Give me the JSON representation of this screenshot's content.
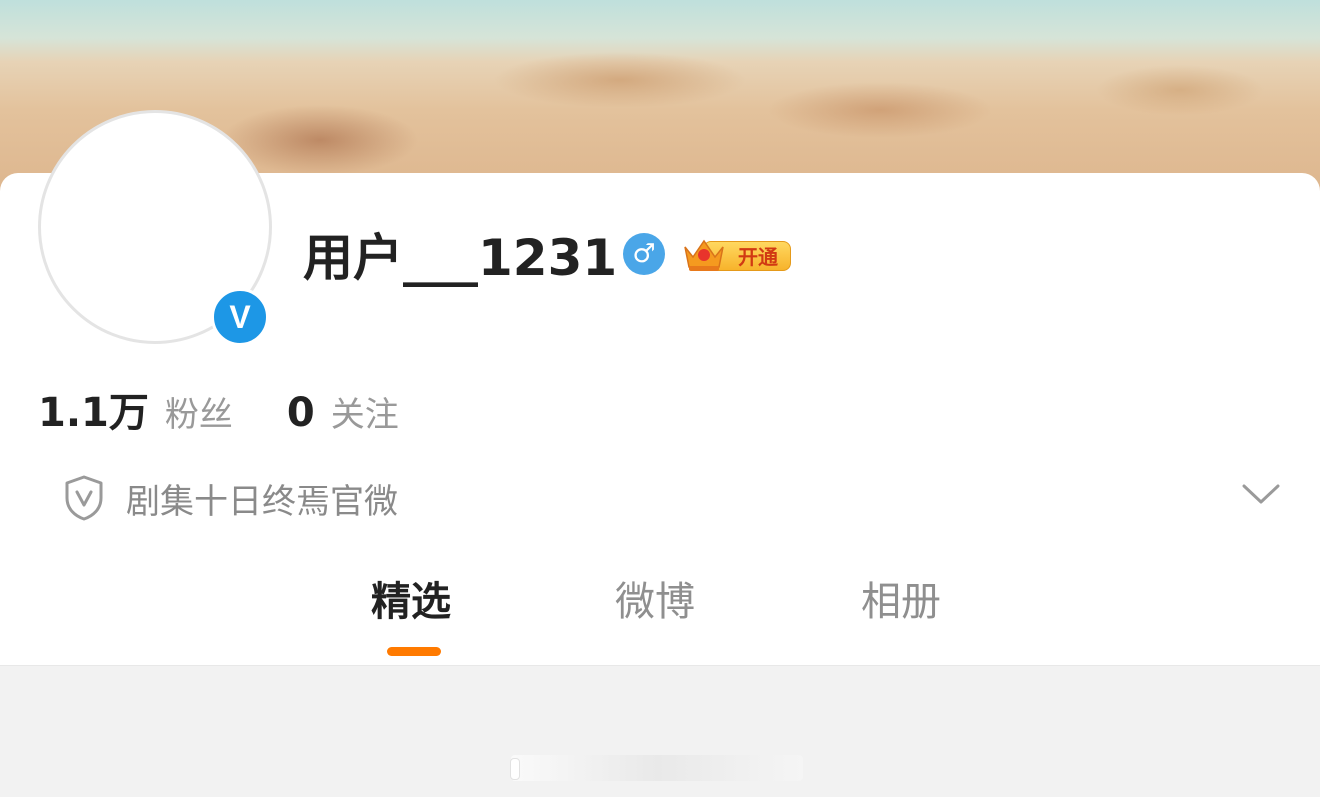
{
  "profile": {
    "username": "用户___1231",
    "gender_symbol": "♂",
    "vip_label": "开通"
  },
  "stats": {
    "followers_count": "1.1万",
    "followers_label": "粉丝",
    "following_count": "0",
    "following_label": "关注"
  },
  "verification": {
    "text": "剧集十日终焉官微"
  },
  "tabs": [
    {
      "label": "精选",
      "active": true
    },
    {
      "label": "微博",
      "active": false
    },
    {
      "label": "相册",
      "active": false
    }
  ],
  "colors": {
    "accent": "#ff7a00",
    "verified_badge": "#1d97e6",
    "gender_badge": "#4aa6e8",
    "vip_gold": "#f7b32b"
  },
  "icons": {
    "verified": "verified-v-icon",
    "gender": "male-icon",
    "vip": "crown-icon",
    "verification": "shield-icon",
    "expand": "chevron-down-icon"
  }
}
